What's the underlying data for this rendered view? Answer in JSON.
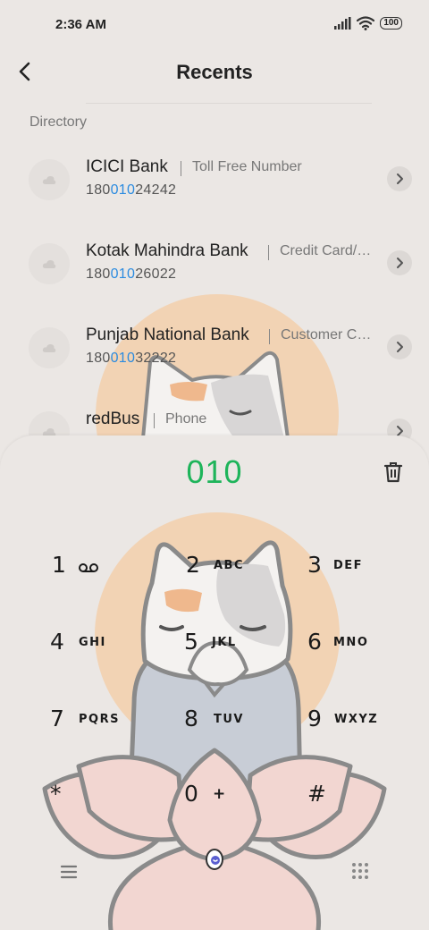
{
  "status_bar": {
    "time": "2:36 AM",
    "battery": "100",
    "icons": [
      "signal-icon",
      "wifi-icon",
      "battery-icon"
    ]
  },
  "header": {
    "title": "Recents",
    "back_icon": "back-arrow-icon"
  },
  "section": {
    "label": "Directory"
  },
  "contacts": [
    {
      "name": "ICICI Bank",
      "tag": "Toll Free Number",
      "number_prefix": "180",
      "number_match": "010",
      "number_suffix": "24242"
    },
    {
      "name": "Kotak Mahindra Bank",
      "tag": "Credit Card/…",
      "number_prefix": "180",
      "number_match": "010",
      "number_suffix": "26022"
    },
    {
      "name": "Punjab National Bank",
      "tag": "Customer C…",
      "number_prefix": "180",
      "number_match": "010",
      "number_suffix": "32222"
    },
    {
      "name": "redBus",
      "tag": "Phone",
      "number_prefix": "",
      "number_match": "",
      "number_suffix": ""
    }
  ],
  "dialer": {
    "input": "010",
    "keys": [
      {
        "digit": "1",
        "letters": ""
      },
      {
        "digit": "2",
        "letters": "ABC"
      },
      {
        "digit": "3",
        "letters": "DEF"
      },
      {
        "digit": "4",
        "letters": "GHI"
      },
      {
        "digit": "5",
        "letters": "JKL"
      },
      {
        "digit": "6",
        "letters": "MNO"
      },
      {
        "digit": "7",
        "letters": "PQRS"
      },
      {
        "digit": "8",
        "letters": "TUV"
      },
      {
        "digit": "9",
        "letters": "WXYZ"
      },
      {
        "digit": "*",
        "letters": ""
      },
      {
        "digit": "0",
        "letters": "+"
      },
      {
        "digit": "#",
        "letters": ""
      }
    ],
    "bottom_icons": [
      "menu-icon",
      "call-icon",
      "keypad-icon"
    ]
  },
  "colors": {
    "background": "#ebe7e4",
    "accent_green": "#1eb45a",
    "match_blue": "#2b8be0",
    "sun": "#f2d3b4",
    "lotus": "#f2d6d1",
    "robe": "#c8cdd6"
  }
}
